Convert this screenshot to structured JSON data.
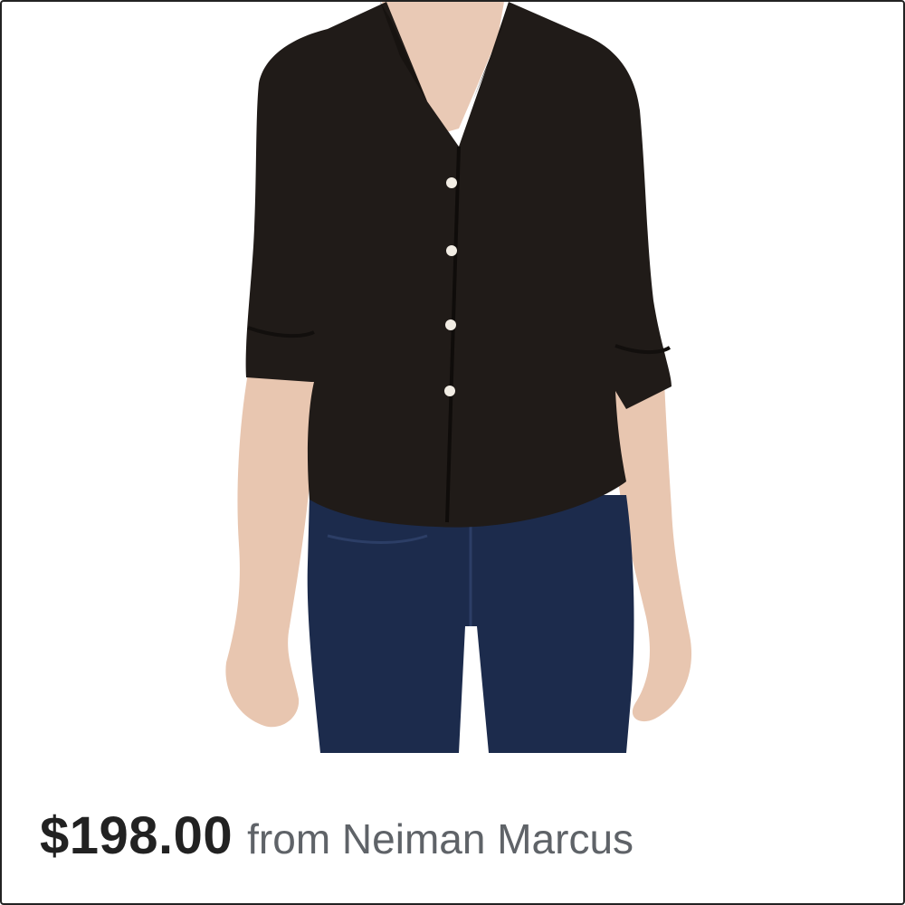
{
  "product": {
    "image_alt": "Black button-front shirt",
    "price": "$198.00",
    "merchant_text": "from Neiman Marcus"
  },
  "colors": {
    "price": "#222222",
    "merchant": "#5f6368",
    "shirt": "#1f1a17",
    "jeans": "#1d2c4d",
    "skin": "#e7c8b3"
  }
}
